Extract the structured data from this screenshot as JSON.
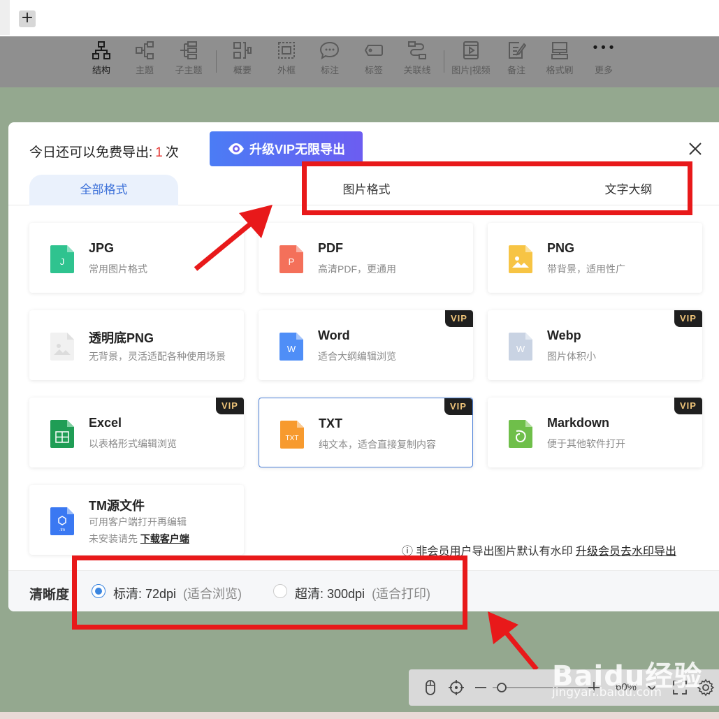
{
  "top": {
    "add_tab": "+"
  },
  "toolbar": {
    "items": [
      {
        "label": "结构",
        "icon": "structure-icon",
        "active": true
      },
      {
        "label": "主题",
        "icon": "topic-icon"
      },
      {
        "label": "子主题",
        "icon": "subtopic-icon"
      },
      {
        "label": "概要",
        "icon": "summary-icon"
      },
      {
        "label": "外框",
        "icon": "boundary-icon"
      },
      {
        "label": "标注",
        "icon": "callout-icon"
      },
      {
        "label": "标签",
        "icon": "tag-icon"
      },
      {
        "label": "关联线",
        "icon": "relation-line-icon"
      },
      {
        "label": "图片|视频",
        "icon": "media-icon"
      },
      {
        "label": "备注",
        "icon": "note-icon"
      },
      {
        "label": "格式刷",
        "icon": "format-painter-icon"
      },
      {
        "label": "更多",
        "icon": "more-icon"
      }
    ]
  },
  "modal": {
    "info_prefix": "今日还可以免费导出:",
    "info_count": "1",
    "info_suffix": "次",
    "vip_button": "升级VIP无限导出",
    "tabs": [
      "全部格式",
      "图片格式",
      "文字大纲"
    ],
    "formats": [
      {
        "title": "JPG",
        "desc": "常用图片格式",
        "vip": false,
        "icon": "jpg-file-icon",
        "color": "#2fc38f",
        "glyph": "J"
      },
      {
        "title": "PDF",
        "desc": "高清PDF，更通用",
        "vip": false,
        "icon": "pdf-file-icon",
        "color": "#f4705a",
        "glyph": "P"
      },
      {
        "title": "PNG",
        "desc": "带背景，适用性广",
        "vip": false,
        "icon": "png-file-icon",
        "color": "#f7c444",
        "glyph": ""
      },
      {
        "title": "透明底PNG",
        "desc": "无背景，灵活适配各种使用场景",
        "vip": false,
        "icon": "transparent-png-file-icon",
        "color": "#e6e6e6",
        "glyph": ""
      },
      {
        "title": "Word",
        "desc": "适合大纲编辑浏览",
        "vip": true,
        "icon": "word-file-icon",
        "color": "#4f8ef7",
        "glyph": "W"
      },
      {
        "title": "Webp",
        "desc": "图片体积小",
        "vip": true,
        "icon": "webp-file-icon",
        "color": "#c9d3e3",
        "glyph": "W"
      },
      {
        "title": "Excel",
        "desc": "以表格形式编辑浏览",
        "vip": true,
        "icon": "excel-file-icon",
        "color": "#1f9d55",
        "glyph": "X"
      },
      {
        "title": "TXT",
        "desc": "纯文本，适合直接复制内容",
        "vip": true,
        "icon": "txt-file-icon",
        "color": "#f79a2e",
        "glyph": "TXT",
        "selected": true
      },
      {
        "title": "Markdown",
        "desc": "便于其他软件打开",
        "vip": true,
        "icon": "markdown-file-icon",
        "color": "#6fbf4a",
        "glyph": ""
      },
      {
        "title": "TM源文件",
        "desc": "可用客户端打开再编辑",
        "desc2_prefix": "未安装请先 ",
        "desc2_link": "下载客户端",
        "vip": false,
        "icon": "tm-file-icon",
        "color": "#3a78f2",
        "glyph": ""
      }
    ],
    "vip_badge": "VIP",
    "watermark_note": "非会员用户导出图片默认有水印",
    "watermark_link": "升级会员去水印导出",
    "resolution": {
      "label": "清晰度",
      "options": [
        {
          "name": "标清: 72dpi",
          "hint": "(适合浏览)",
          "checked": true
        },
        {
          "name": "超清: 300dpi",
          "hint": "(适合打印)",
          "checked": false
        }
      ]
    }
  },
  "zoom": {
    "value": "60%"
  },
  "watermark_site": {
    "brand": "Baidu经验",
    "url": "jingyan.baidu.com"
  }
}
